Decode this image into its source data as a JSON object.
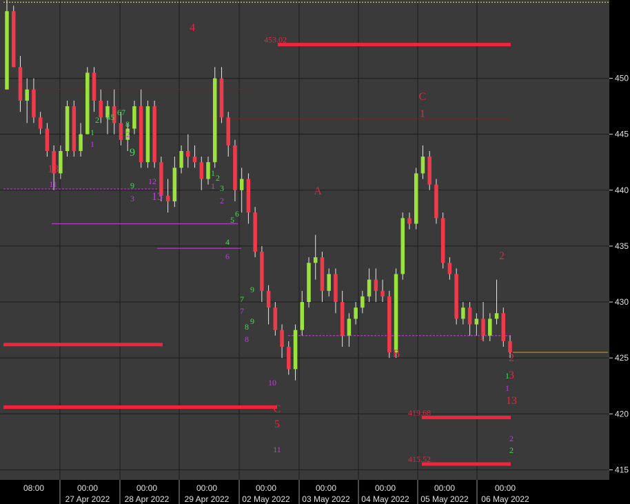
{
  "colors": {
    "background": "#3a3a3a",
    "page": "#000000",
    "grid": "#1c1c1c",
    "up_body": "#9be23c",
    "down_body": "#ef3a4b",
    "wick": "#e8e8e8",
    "support_red": "#f0243c",
    "trend_magenta": "#b43cc8",
    "resist_dark": "#8b1a1a",
    "price_line": "#d8a02a",
    "dotted_top": "#e8d020",
    "label_red": "#e02840",
    "label_green": "#3ee04a",
    "label_purple": "#c23ce0",
    "axis_text": "#e0e0e0"
  },
  "chart_data": {
    "type": "candlestick",
    "title": "",
    "xlabel": "",
    "ylabel": "",
    "ylim": [
      414.1,
      457.0
    ],
    "y_ticks": [
      415,
      420,
      425,
      430,
      435,
      440,
      445,
      450
    ],
    "x_tick_labels": [
      {
        "top": "08:00",
        "bottom": ""
      },
      {
        "top": "00:00",
        "bottom": "27 Apr 2022"
      },
      {
        "top": "00:00",
        "bottom": "28 Apr 2022"
      },
      {
        "top": "00:00",
        "bottom": "29 Apr 2022"
      },
      {
        "top": "00:00",
        "bottom": "02 May 2022"
      },
      {
        "top": "00:00",
        "bottom": "03 May 2022"
      },
      {
        "top": "00:00",
        "bottom": "04 May 2022"
      },
      {
        "top": "00:00",
        "bottom": "05 May 2022"
      },
      {
        "top": "00:00",
        "bottom": "06 May 2022"
      }
    ],
    "candles": [
      {
        "o": 449,
        "h": 457,
        "l": 449,
        "c": 456
      },
      {
        "o": 456,
        "h": 456.5,
        "l": 451,
        "c": 451
      },
      {
        "o": 451,
        "h": 452,
        "l": 447,
        "c": 448
      },
      {
        "o": 448,
        "h": 450,
        "l": 446,
        "c": 449
      },
      {
        "o": 449,
        "h": 450,
        "l": 446,
        "c": 446.5
      },
      {
        "o": 446.5,
        "h": 447,
        "l": 445,
        "c": 445.5
      },
      {
        "o": 445.5,
        "h": 446,
        "l": 443,
        "c": 443.5
      },
      {
        "o": 443.5,
        "h": 444,
        "l": 440,
        "c": 441.5
      },
      {
        "o": 441.5,
        "h": 444,
        "l": 441,
        "c": 443.5
      },
      {
        "o": 443.5,
        "h": 448,
        "l": 443,
        "c": 447.5
      },
      {
        "o": 447.5,
        "h": 448,
        "l": 443,
        "c": 443.5
      },
      {
        "o": 443.5,
        "h": 446,
        "l": 443,
        "c": 445
      },
      {
        "o": 445,
        "h": 451,
        "l": 445,
        "c": 450.5
      },
      {
        "o": 450.5,
        "h": 451,
        "l": 447,
        "c": 448
      },
      {
        "o": 448,
        "h": 449,
        "l": 446,
        "c": 446.5
      },
      {
        "o": 446.5,
        "h": 448,
        "l": 445,
        "c": 447.5
      },
      {
        "o": 447.5,
        "h": 449,
        "l": 445,
        "c": 446
      },
      {
        "o": 446,
        "h": 447,
        "l": 444,
        "c": 444.5
      },
      {
        "o": 444.5,
        "h": 446,
        "l": 443.5,
        "c": 445.5
      },
      {
        "o": 445.5,
        "h": 448,
        "l": 445,
        "c": 447.5
      },
      {
        "o": 447.5,
        "h": 449,
        "l": 442,
        "c": 442.5
      },
      {
        "o": 442.5,
        "h": 448,
        "l": 442,
        "c": 447.5
      },
      {
        "o": 447.5,
        "h": 448,
        "l": 442,
        "c": 442.5
      },
      {
        "o": 442.5,
        "h": 443,
        "l": 439,
        "c": 439.5
      },
      {
        "o": 439.5,
        "h": 441,
        "l": 438,
        "c": 439
      },
      {
        "o": 439,
        "h": 443,
        "l": 438.5,
        "c": 442
      },
      {
        "o": 442,
        "h": 444,
        "l": 441.5,
        "c": 443.5
      },
      {
        "o": 443.5,
        "h": 445,
        "l": 442,
        "c": 443
      },
      {
        "o": 443,
        "h": 444,
        "l": 442,
        "c": 442.5
      },
      {
        "o": 442.5,
        "h": 443,
        "l": 440,
        "c": 441
      },
      {
        "o": 441,
        "h": 443,
        "l": 440.5,
        "c": 442.5
      },
      {
        "o": 442.5,
        "h": 451,
        "l": 442,
        "c": 450
      },
      {
        "o": 450,
        "h": 451,
        "l": 446,
        "c": 446.5
      },
      {
        "o": 446.5,
        "h": 447,
        "l": 443,
        "c": 444
      },
      {
        "o": 444,
        "h": 444.5,
        "l": 439,
        "c": 440
      },
      {
        "o": 440,
        "h": 442,
        "l": 438,
        "c": 441
      },
      {
        "o": 441,
        "h": 441.5,
        "l": 437,
        "c": 438
      },
      {
        "o": 438,
        "h": 438.5,
        "l": 434,
        "c": 434.5
      },
      {
        "o": 434.5,
        "h": 435,
        "l": 430,
        "c": 431
      },
      {
        "o": 431,
        "h": 431.5,
        "l": 428,
        "c": 429.5
      },
      {
        "o": 429.5,
        "h": 430,
        "l": 427,
        "c": 427.5
      },
      {
        "o": 427.5,
        "h": 428,
        "l": 425,
        "c": 426
      },
      {
        "o": 426,
        "h": 426.5,
        "l": 423.5,
        "c": 424
      },
      {
        "o": 424,
        "h": 428,
        "l": 423,
        "c": 427.5
      },
      {
        "o": 427.5,
        "h": 431,
        "l": 427,
        "c": 430
      },
      {
        "o": 430,
        "h": 434,
        "l": 429.5,
        "c": 433.5
      },
      {
        "o": 433.5,
        "h": 436,
        "l": 432,
        "c": 434
      },
      {
        "o": 434,
        "h": 434.5,
        "l": 430,
        "c": 431
      },
      {
        "o": 431,
        "h": 433,
        "l": 430.5,
        "c": 432.5
      },
      {
        "o": 432.5,
        "h": 433,
        "l": 429,
        "c": 430
      },
      {
        "o": 430,
        "h": 431,
        "l": 426,
        "c": 427
      },
      {
        "o": 427,
        "h": 429,
        "l": 426,
        "c": 428.5
      },
      {
        "o": 428.5,
        "h": 430,
        "l": 428,
        "c": 429.5
      },
      {
        "o": 429.5,
        "h": 431,
        "l": 429,
        "c": 430.5
      },
      {
        "o": 430.5,
        "h": 433,
        "l": 430,
        "c": 432
      },
      {
        "o": 432,
        "h": 433,
        "l": 430,
        "c": 431
      },
      {
        "o": 431,
        "h": 432,
        "l": 430,
        "c": 430.5
      },
      {
        "o": 430.5,
        "h": 431,
        "l": 425,
        "c": 425.5
      },
      {
        "o": 425.5,
        "h": 433,
        "l": 425,
        "c": 432.5
      },
      {
        "o": 432.5,
        "h": 438,
        "l": 432,
        "c": 437.5
      },
      {
        "o": 437.5,
        "h": 438,
        "l": 436.5,
        "c": 437
      },
      {
        "o": 437,
        "h": 442,
        "l": 436.5,
        "c": 441.5
      },
      {
        "o": 441.5,
        "h": 444,
        "l": 441,
        "c": 443
      },
      {
        "o": 443,
        "h": 443.5,
        "l": 440,
        "c": 440.5
      },
      {
        "o": 440.5,
        "h": 441,
        "l": 437,
        "c": 437.5
      },
      {
        "o": 437.5,
        "h": 438,
        "l": 433,
        "c": 433.5
      },
      {
        "o": 433.5,
        "h": 434,
        "l": 432,
        "c": 432.5
      },
      {
        "o": 432.5,
        "h": 433,
        "l": 428,
        "c": 428.5
      },
      {
        "o": 428.5,
        "h": 430,
        "l": 428,
        "c": 429.5
      },
      {
        "o": 429.5,
        "h": 430,
        "l": 427,
        "c": 428
      },
      {
        "o": 428,
        "h": 429,
        "l": 427,
        "c": 428.5
      },
      {
        "o": 428.5,
        "h": 430,
        "l": 426.5,
        "c": 427
      },
      {
        "o": 427,
        "h": 429,
        "l": 426.5,
        "c": 428.5
      },
      {
        "o": 428.5,
        "h": 432,
        "l": 428,
        "c": 429
      },
      {
        "o": 429,
        "h": 429.5,
        "l": 426,
        "c": 426.5
      },
      {
        "o": 426.5,
        "h": 427,
        "l": 425,
        "c": 425.5
      }
    ],
    "horizontal_lines": [
      {
        "y": 453.02,
        "label": "453.02",
        "style": "support"
      },
      {
        "y": 419.68,
        "label": "419.68",
        "style": "support"
      },
      {
        "y": 415.52,
        "label": "415.52",
        "style": "support"
      },
      {
        "y": 420.6,
        "label": "",
        "style": "support"
      },
      {
        "y": 426.2,
        "label": "",
        "style": "support"
      },
      {
        "y": 449.0,
        "label": "",
        "style": "resist"
      },
      {
        "y": 446.4,
        "label": "",
        "style": "resist"
      },
      {
        "y": 440.1,
        "label": "",
        "style": "trend"
      },
      {
        "y": 437.0,
        "label": "",
        "style": "trend"
      },
      {
        "y": 434.8,
        "label": "",
        "style": "trend"
      },
      {
        "y": 427.0,
        "label": "",
        "style": "trend"
      },
      {
        "y": 425.5,
        "label": "",
        "style": "price"
      },
      {
        "y": 456.8,
        "label": "",
        "style": "dotted"
      }
    ],
    "wave_labels": [
      {
        "text": "4",
        "x": 279,
        "y": 45,
        "color": "red",
        "size": 16
      },
      {
        "text": "A",
        "x": 461,
        "y": 282,
        "color": "red",
        "size": 16
      },
      {
        "text": "C",
        "x": 613,
        "y": 145,
        "color": "red",
        "size": 16
      },
      {
        "text": "1",
        "x": 613,
        "y": 170,
        "color": "red",
        "size": 16
      },
      {
        "text": "2",
        "x": 728,
        "y": 376,
        "color": "red",
        "size": 16
      },
      {
        "text": "B",
        "x": 575,
        "y": 518,
        "color": "red",
        "size": 16
      },
      {
        "text": "1",
        "x": 699,
        "y": 493,
        "color": "red",
        "size": 16
      },
      {
        "text": "C",
        "x": 402,
        "y": 598,
        "color": "red",
        "size": 16
      },
      {
        "text": "5",
        "x": 402,
        "y": 620,
        "color": "red",
        "size": 16
      },
      {
        "text": "13",
        "x": 77,
        "y": 250,
        "color": "red",
        "size": 16
      },
      {
        "text": "13",
        "x": 228,
        "y": 290,
        "color": "purple",
        "size": 16
      },
      {
        "text": "2",
        "x": 742,
        "y": 524,
        "color": "red",
        "size": 16
      },
      {
        "text": "3",
        "x": 742,
        "y": 549,
        "color": "red",
        "size": 16
      },
      {
        "text": "13",
        "x": 742,
        "y": 586,
        "color": "red",
        "size": 16
      },
      {
        "text": "11",
        "x": 77,
        "y": 271,
        "color": "purple",
        "size": 12
      },
      {
        "text": "9",
        "x": 192,
        "y": 226,
        "color": "green",
        "size": 16
      },
      {
        "text": "9",
        "x": 192,
        "y": 273,
        "color": "green",
        "size": 12
      },
      {
        "text": "3",
        "x": 192,
        "y": 292,
        "color": "purple",
        "size": 12
      },
      {
        "text": "12",
        "x": 221,
        "y": 267,
        "color": "purple",
        "size": 12
      },
      {
        "text": "1",
        "x": 134,
        "y": 196,
        "color": "green",
        "size": 12
      },
      {
        "text": "1",
        "x": 134,
        "y": 213,
        "color": "purple",
        "size": 12
      },
      {
        "text": "2",
        "x": 141,
        "y": 178,
        "color": "green",
        "size": 12
      },
      {
        "text": "45",
        "x": 160,
        "y": 174,
        "color": "green",
        "size": 12
      },
      {
        "text": "67",
        "x": 176,
        "y": 167,
        "color": "green",
        "size": 12
      },
      {
        "text": "8",
        "x": 185,
        "y": 184,
        "color": "green",
        "size": 12
      },
      {
        "text": "2",
        "x": 186,
        "y": 199,
        "color": "purple",
        "size": 12
      },
      {
        "text": "1",
        "x": 309,
        "y": 255,
        "color": "green",
        "size": 12
      },
      {
        "text": "2",
        "x": 316,
        "y": 262,
        "color": "green",
        "size": 12
      },
      {
        "text": "1",
        "x": 309,
        "y": 274,
        "color": "purple",
        "size": 12
      },
      {
        "text": "3",
        "x": 322,
        "y": 277,
        "color": "green",
        "size": 12
      },
      {
        "text": "2",
        "x": 322,
        "y": 295,
        "color": "purple",
        "size": 12
      },
      {
        "text": "5",
        "x": 337,
        "y": 323,
        "color": "green",
        "size": 12
      },
      {
        "text": "4",
        "x": 330,
        "y": 355,
        "color": "green",
        "size": 12
      },
      {
        "text": "6",
        "x": 330,
        "y": 376,
        "color": "purple",
        "size": 12
      },
      {
        "text": "6",
        "x": 344,
        "y": 314,
        "color": "green",
        "size": 12
      },
      {
        "text": "7",
        "x": 351,
        "y": 438,
        "color": "green",
        "size": 12
      },
      {
        "text": "9",
        "x": 366,
        "y": 424,
        "color": "green",
        "size": 12
      },
      {
        "text": "7",
        "x": 351,
        "y": 455,
        "color": "purple",
        "size": 12
      },
      {
        "text": "8",
        "x": 358,
        "y": 478,
        "color": "green",
        "size": 12
      },
      {
        "text": "9",
        "x": 366,
        "y": 470,
        "color": "green",
        "size": 12
      },
      {
        "text": "8",
        "x": 358,
        "y": 496,
        "color": "purple",
        "size": 12
      },
      {
        "text": "10",
        "x": 395,
        "y": 559,
        "color": "purple",
        "size": 12
      },
      {
        "text": "11",
        "x": 402,
        "y": 656,
        "color": "purple",
        "size": 12
      },
      {
        "text": "1",
        "x": 736,
        "y": 549,
        "color": "green",
        "size": 12
      },
      {
        "text": "1",
        "x": 736,
        "y": 567,
        "color": "purple",
        "size": 12
      },
      {
        "text": "2",
        "x": 742,
        "y": 640,
        "color": "purple",
        "size": 12
      },
      {
        "text": "2",
        "x": 742,
        "y": 657,
        "color": "green",
        "size": 12
      }
    ]
  }
}
